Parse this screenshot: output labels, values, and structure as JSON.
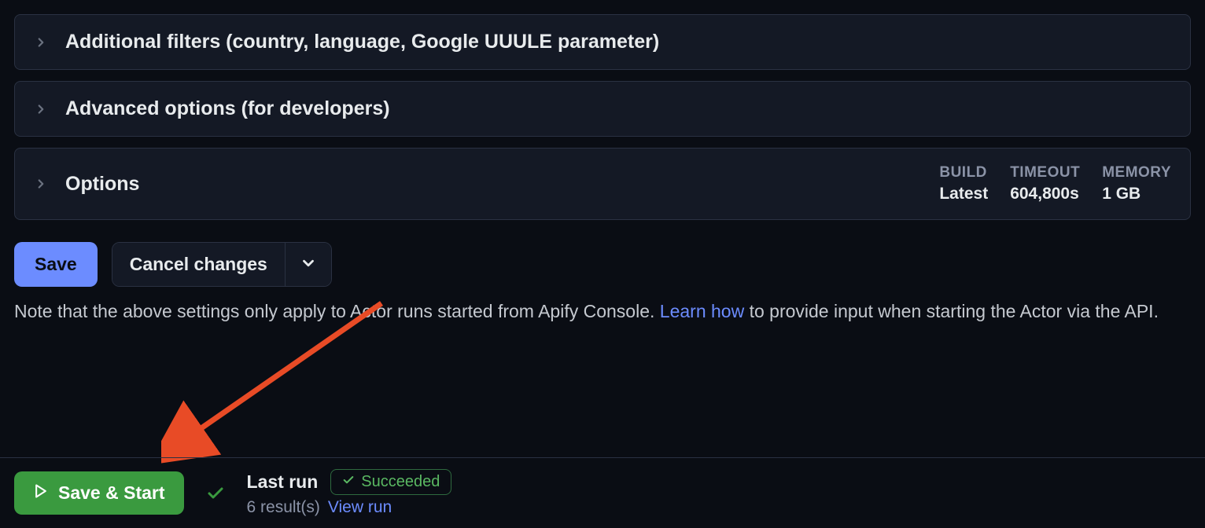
{
  "sections": {
    "filters_title": "Additional filters (country, language, Google UUULE parameter)",
    "advanced_title": "Advanced options (for developers)",
    "options_title": "Options"
  },
  "options_stats": {
    "build_label": "BUILD",
    "build_value": "Latest",
    "timeout_label": "TIMEOUT",
    "timeout_value": "604,800s",
    "memory_label": "MEMORY",
    "memory_value": "1 GB"
  },
  "buttons": {
    "save": "Save",
    "cancel": "Cancel changes",
    "save_start": "Save & Start"
  },
  "note": {
    "pre": "Note that the above settings only apply to Actor runs started from Apify Console. ",
    "link": "Learn how",
    "post": " to provide input when starting the Actor via the API."
  },
  "footer": {
    "last_run_label": "Last run",
    "succeeded": "Succeeded",
    "results": "6 result(s)",
    "view_run": "View run"
  }
}
